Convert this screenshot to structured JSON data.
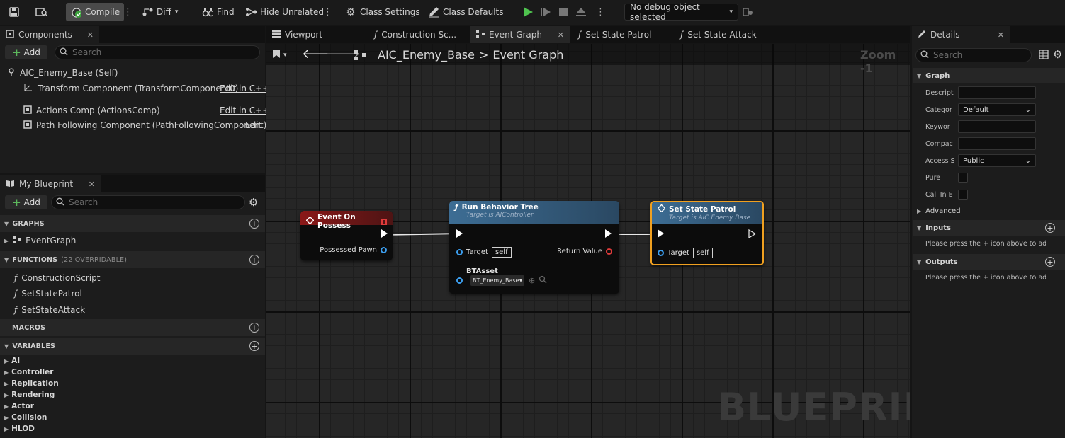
{
  "toolbar": {
    "compile": "Compile",
    "diff": "Diff",
    "find": "Find",
    "hide_unrelated": "Hide Unrelated",
    "class_settings": "Class Settings",
    "class_defaults": "Class Defaults",
    "debug_object": "No debug object selected"
  },
  "components": {
    "tab": "Components",
    "add": "Add",
    "search_placeholder": "Search",
    "root": "AIC_Enemy_Base (Self)",
    "items": [
      {
        "label": "Transform Component (TransformComponent0)",
        "link": "Edit in C++"
      },
      {
        "label": "Actions Comp (ActionsComp)",
        "link": "Edit in C++"
      },
      {
        "label": "Path Following Component (PathFollowingComponent)",
        "link": "Edit"
      }
    ]
  },
  "my_blueprint": {
    "tab": "My Blueprint",
    "add": "Add",
    "search_placeholder": "Search",
    "graphs_header": "GRAPHS",
    "graphs": [
      "EventGraph"
    ],
    "functions_header": "FUNCTIONS",
    "functions_sub": "(22 OVERRIDABLE)",
    "functions": [
      "ConstructionScript",
      "SetStatePatrol",
      "SetStateAttack"
    ],
    "macros_header": "MACROS",
    "variables_header": "VARIABLES",
    "variables": [
      "AI",
      "Controller",
      "Replication",
      "Rendering",
      "Actor",
      "Collision",
      "HLOD"
    ]
  },
  "editor_tabs": [
    "Viewport",
    "Construction Sc...",
    "Event Graph",
    "Set State Patrol",
    "Set State Attack"
  ],
  "breadcrumb": {
    "asset": "AIC_Enemy_Base",
    "separator": ">",
    "graph": "Event Graph"
  },
  "zoom": "Zoom -1",
  "watermark": "BLUEPRINT",
  "nodes": {
    "event_possess": {
      "title": "Event On Possess",
      "pin": "Possessed Pawn"
    },
    "run_bt": {
      "title": "Run Behavior Tree",
      "subtitle": "Target is AIController",
      "target": "Target",
      "self": "self",
      "return": "Return Value",
      "btasset": "BTAsset",
      "btvalue": "BT_Enemy_Base"
    },
    "set_patrol": {
      "title": "Set State Patrol",
      "subtitle": "Target is AIC Enemy Base",
      "target": "Target",
      "self": "self"
    }
  },
  "details": {
    "tab": "Details",
    "search_placeholder": "Search",
    "graph_header": "Graph",
    "rows": [
      {
        "label": "Descript",
        "value": ""
      },
      {
        "label": "Categor",
        "value": "Default"
      },
      {
        "label": "Keywor",
        "value": ""
      },
      {
        "label": "Compac",
        "value": ""
      },
      {
        "label": "Access S",
        "value": "Public"
      },
      {
        "label": "Pure",
        "value": ""
      },
      {
        "label": "Call In E",
        "value": ""
      }
    ],
    "advanced": "Advanced",
    "inputs_header": "Inputs",
    "inputs_hint": "Please press the + icon above to add pa",
    "outputs_header": "Outputs",
    "outputs_hint": "Please press the + icon above to add pa"
  },
  "colors": {
    "event_node": "#8a1818",
    "function_node": "#3d6d94",
    "selected_border": "#f0a020",
    "play": "#4fc34f"
  }
}
